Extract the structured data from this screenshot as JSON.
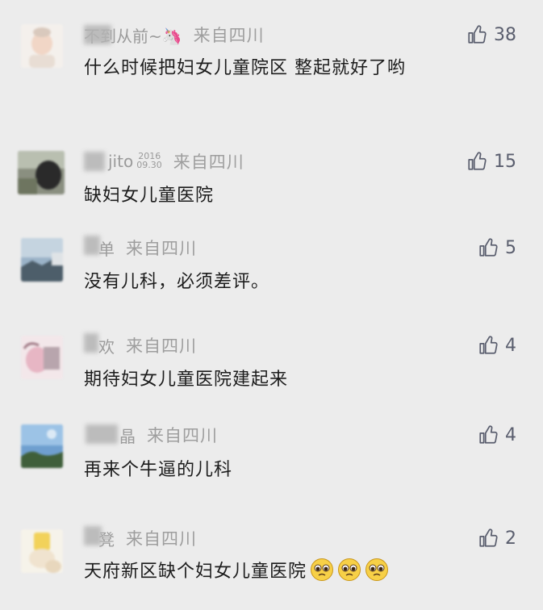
{
  "comments": [
    {
      "name": "不到从前~🦄",
      "location": "来自四川",
      "text": "什么时候把妇女儿童院区 整起就好了哟",
      "likes": "38",
      "avatar": "baby-avatar-icon"
    },
    {
      "name": "jito",
      "name_sup": "2016",
      "name_sub": "09.30",
      "location": "来自四川",
      "text": "缺妇女儿童医院",
      "likes": "15",
      "avatar": "photo-avatar-icon"
    },
    {
      "name": "单",
      "location": "来自四川",
      "text": "没有儿科，必须差评。",
      "likes": "5",
      "avatar": "landscape-avatar-icon"
    },
    {
      "name": "欢",
      "location": "来自四川",
      "text": "期待妇女儿童医院建起来",
      "likes": "4",
      "avatar": "pink-avatar-icon"
    },
    {
      "name": "晶",
      "location": "来自四川",
      "text": "再来个牛逼的儿科",
      "likes": "4",
      "avatar": "sky-avatar-icon"
    },
    {
      "name": "凳",
      "location": "来自四川",
      "text": "天府新区缺个妇女儿童医院",
      "likes": "2",
      "avatar": "yellow-avatar-icon",
      "emojis": [
        "pleading-face-icon",
        "pleading-face-icon",
        "pleading-face-icon"
      ]
    }
  ],
  "colors": {
    "background": "#ececec",
    "meta_text": "#9e9e9e",
    "body_text": "#1c1c1c",
    "like_icon": "#5a5e6e"
  }
}
